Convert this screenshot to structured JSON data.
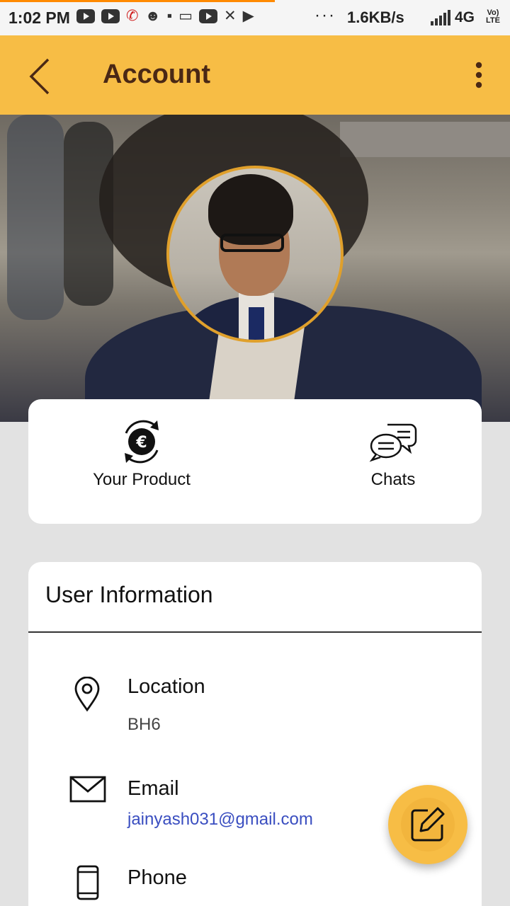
{
  "status_bar": {
    "time": "1:02 PM",
    "net_speed": "1.6KB/s",
    "network": "4G",
    "volte_top": "Vo)",
    "volte_bottom": "LTE",
    "more": "···"
  },
  "app_bar": {
    "title": "Account",
    "background_color": "#f7bd45",
    "title_color": "#4a2815"
  },
  "quick_actions": [
    {
      "label": "Your Product",
      "icon": "currency-exchange-icon"
    },
    {
      "label": "Chats",
      "icon": "chat-bubbles-icon"
    }
  ],
  "user_info": {
    "title": "User Information",
    "rows": [
      {
        "label": "Location",
        "value": "BH6",
        "icon": "location-pin-icon",
        "value_color": "#444444"
      },
      {
        "label": "Email",
        "value": "jainyash031@gmail.com",
        "icon": "envelope-icon",
        "value_color": "#3a4ec0"
      },
      {
        "label": "Phone",
        "value": "",
        "icon": "phone-icon"
      }
    ]
  },
  "fab": {
    "icon": "edit-icon",
    "color": "#f7bd45"
  }
}
